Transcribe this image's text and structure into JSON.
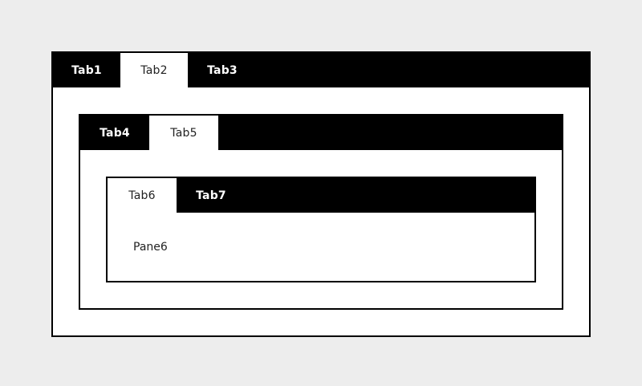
{
  "outer_tabs": {
    "tabs": [
      "Tab1",
      "Tab2",
      "Tab3"
    ],
    "active": "Tab2"
  },
  "middle_tabs": {
    "tabs": [
      "Tab4",
      "Tab5"
    ],
    "active": "Tab5"
  },
  "inner_tabs": {
    "tabs": [
      "Tab6",
      "Tab7"
    ],
    "active": "Tab6",
    "pane_text": "Pane6"
  },
  "colors": {
    "background": "#ededed",
    "tabbar": "#000000",
    "active_tab": "#ffffff",
    "pane": "#ffffff"
  }
}
